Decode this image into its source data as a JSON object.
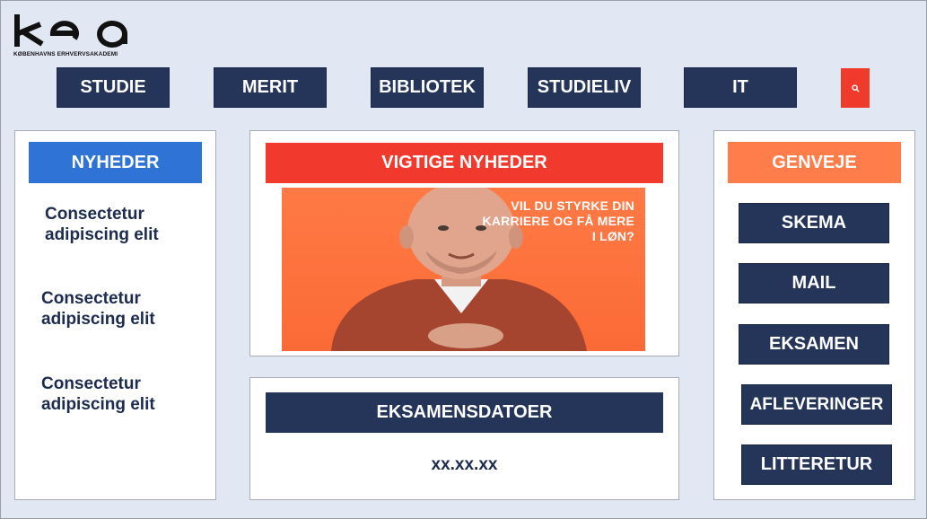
{
  "brand": {
    "logo_text": "kea",
    "logo_subtitle": "KØBENHAVNS ERHVERVSAKADEMI"
  },
  "nav": {
    "items": [
      {
        "label": "STUDIE"
      },
      {
        "label": "MERIT"
      },
      {
        "label": "BIBLIOTEK"
      },
      {
        "label": "STUDIELIV"
      },
      {
        "label": "IT"
      }
    ],
    "search_icon": "search-icon"
  },
  "news": {
    "title": "NYHEDER",
    "items": [
      {
        "text": "Consectetur adipiscing elit"
      },
      {
        "text": "Consectetur adipiscing elit"
      },
      {
        "text": "Consectetur adipiscing elit"
      }
    ]
  },
  "important": {
    "title": "VIGTIGE NYHEDER",
    "banner_text": "VIL DU STYRKE DIN KARRIERE OG FÅ MERE I LØN?"
  },
  "exams": {
    "title": "EKSAMENSDATOER",
    "date": "xx.xx.xx"
  },
  "shortcuts": {
    "title": "GENVEJE",
    "items": [
      {
        "label": "SKEMA"
      },
      {
        "label": "MAIL"
      },
      {
        "label": "EKSAMEN"
      },
      {
        "label": "AFLEVERINGER"
      },
      {
        "label": "LITTERETUR"
      }
    ]
  },
  "colors": {
    "navy": "#253459",
    "blue_header": "#2f73d6",
    "red_header": "#f2392d",
    "orange_header": "#ff7d4a",
    "search": "#f03a2c",
    "background": "#e2e8f3"
  }
}
